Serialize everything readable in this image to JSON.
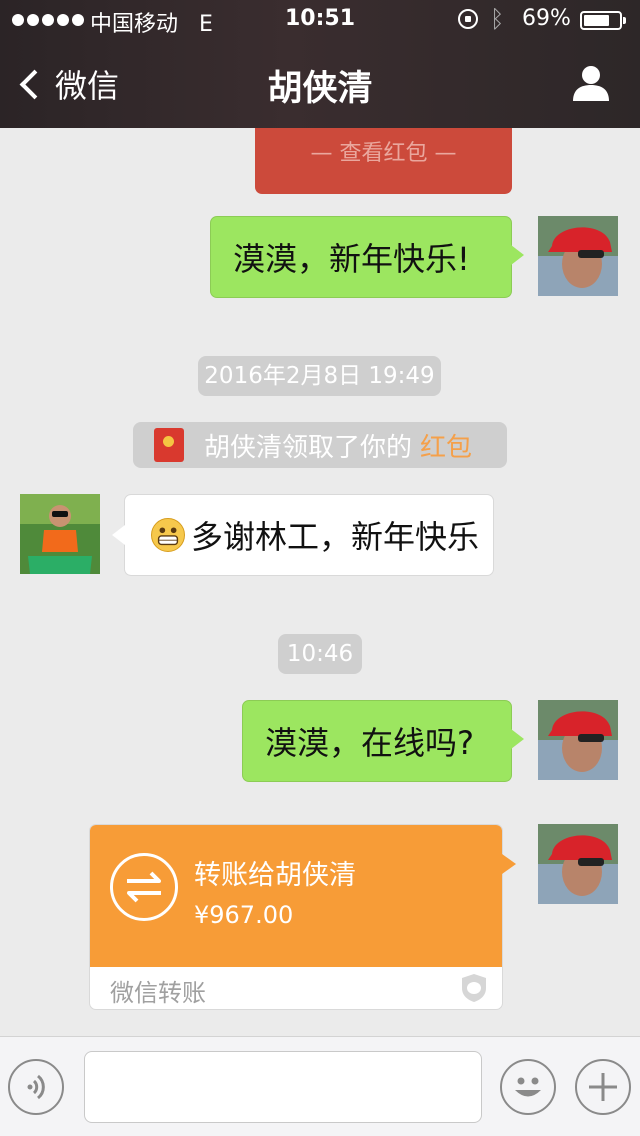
{
  "status_bar": {
    "carrier": "中国移动",
    "network": "E",
    "time": "10:51",
    "battery": "69%"
  },
  "nav": {
    "back_label": "微信",
    "title": "胡侠清",
    "icons": [
      "back-chevron-icon",
      "profile-icon"
    ]
  },
  "chat": {
    "redpacket_view_label": "— 查看红包 —",
    "msg1": "漠漠，新年快乐!",
    "timestamp1": "2016年2月8日 19:49",
    "system_notice": {
      "text": "胡侠清领取了你的",
      "link": "红包"
    },
    "msg2": "多谢林工，新年快乐",
    "timestamp2": "10:46",
    "msg3": "漠漠，在线吗?",
    "transfer": {
      "title": "转账给胡侠清",
      "amount": "¥967.00",
      "label": "微信转账"
    }
  },
  "colors": {
    "nav_bg": "#2b2426",
    "outgoing_bubble": "#9ce660",
    "incoming_bubble": "#ffffff",
    "transfer_bg": "#f79c37",
    "redpack_bg": "#cc4a3b",
    "link": "#f5a04a",
    "chat_bg": "#ebebeb"
  },
  "input_bar": {
    "icons": [
      "voice-icon",
      "emoji-icon",
      "plus-icon"
    ],
    "placeholder": ""
  }
}
